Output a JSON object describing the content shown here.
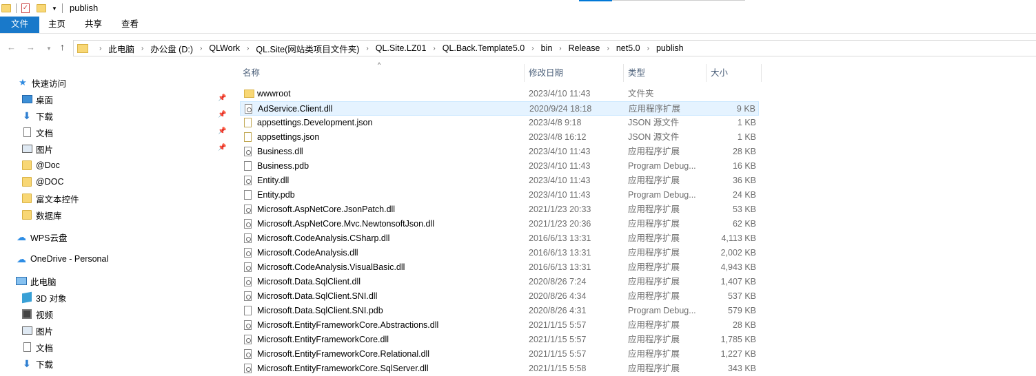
{
  "window": {
    "title": "publish"
  },
  "ribbon": {
    "tabs": {
      "file": "文件",
      "home": "主页",
      "share": "共享",
      "view": "查看"
    }
  },
  "address": {
    "crumbs": [
      "此电脑",
      "办公盘 (D:)",
      "QLWork",
      "QL.Site(网站类项目文件夹)",
      "QL.Site.LZ01",
      "QL.Back.Template5.0",
      "bin",
      "Release",
      "net5.0",
      "publish"
    ]
  },
  "sidebar": {
    "quick_access": "快速访问",
    "pinned": [
      {
        "label": "桌面",
        "icon": "desktop-icon"
      },
      {
        "label": "下载",
        "icon": "download-icon"
      },
      {
        "label": "文档",
        "icon": "document-icon"
      },
      {
        "label": "图片",
        "icon": "picture-icon"
      }
    ],
    "folders": [
      "@Doc",
      "@DOC",
      "富文本控件",
      "数据库"
    ],
    "wps": "WPS云盘",
    "onedrive": "OneDrive - Personal",
    "this_pc": "此电脑",
    "pc_items": [
      {
        "label": "3D 对象",
        "icon": "3d-objects-icon"
      },
      {
        "label": "视频",
        "icon": "video-icon"
      },
      {
        "label": "图片",
        "icon": "picture-icon"
      },
      {
        "label": "文档",
        "icon": "document-icon"
      },
      {
        "label": "下载",
        "icon": "download-icon"
      }
    ]
  },
  "columns": {
    "name": "名称",
    "date": "修改日期",
    "type": "类型",
    "size": "大小"
  },
  "files": [
    {
      "name": "wwwroot",
      "date": "2023/4/10 11:43",
      "type": "文件夹",
      "size": "",
      "icon": "folder"
    },
    {
      "name": "AdService.Client.dll",
      "date": "2020/9/24 18:18",
      "type": "应用程序扩展",
      "size": "9 KB",
      "icon": "dll",
      "selected": true
    },
    {
      "name": "appsettings.Development.json",
      "date": "2023/4/8 9:18",
      "type": "JSON 源文件",
      "size": "1 KB",
      "icon": "json"
    },
    {
      "name": "appsettings.json",
      "date": "2023/4/8 16:12",
      "type": "JSON 源文件",
      "size": "1 KB",
      "icon": "json"
    },
    {
      "name": "Business.dll",
      "date": "2023/4/10 11:43",
      "type": "应用程序扩展",
      "size": "28 KB",
      "icon": "dll"
    },
    {
      "name": "Business.pdb",
      "date": "2023/4/10 11:43",
      "type": "Program Debug...",
      "size": "16 KB",
      "icon": "pdb"
    },
    {
      "name": "Entity.dll",
      "date": "2023/4/10 11:43",
      "type": "应用程序扩展",
      "size": "36 KB",
      "icon": "dll"
    },
    {
      "name": "Entity.pdb",
      "date": "2023/4/10 11:43",
      "type": "Program Debug...",
      "size": "24 KB",
      "icon": "pdb"
    },
    {
      "name": "Microsoft.AspNetCore.JsonPatch.dll",
      "date": "2021/1/23 20:33",
      "type": "应用程序扩展",
      "size": "53 KB",
      "icon": "dll"
    },
    {
      "name": "Microsoft.AspNetCore.Mvc.NewtonsoftJson.dll",
      "date": "2021/1/23 20:36",
      "type": "应用程序扩展",
      "size": "62 KB",
      "icon": "dll"
    },
    {
      "name": "Microsoft.CodeAnalysis.CSharp.dll",
      "date": "2016/6/13 13:31",
      "type": "应用程序扩展",
      "size": "4,113 KB",
      "icon": "dll"
    },
    {
      "name": "Microsoft.CodeAnalysis.dll",
      "date": "2016/6/13 13:31",
      "type": "应用程序扩展",
      "size": "2,002 KB",
      "icon": "dll"
    },
    {
      "name": "Microsoft.CodeAnalysis.VisualBasic.dll",
      "date": "2016/6/13 13:31",
      "type": "应用程序扩展",
      "size": "4,943 KB",
      "icon": "dll"
    },
    {
      "name": "Microsoft.Data.SqlClient.dll",
      "date": "2020/8/26 7:24",
      "type": "应用程序扩展",
      "size": "1,407 KB",
      "icon": "dll"
    },
    {
      "name": "Microsoft.Data.SqlClient.SNI.dll",
      "date": "2020/8/26 4:34",
      "type": "应用程序扩展",
      "size": "537 KB",
      "icon": "dll"
    },
    {
      "name": "Microsoft.Data.SqlClient.SNI.pdb",
      "date": "2020/8/26 4:31",
      "type": "Program Debug...",
      "size": "579 KB",
      "icon": "pdb"
    },
    {
      "name": "Microsoft.EntityFrameworkCore.Abstractions.dll",
      "date": "2021/1/15 5:57",
      "type": "应用程序扩展",
      "size": "28 KB",
      "icon": "dll"
    },
    {
      "name": "Microsoft.EntityFrameworkCore.dll",
      "date": "2021/1/15 5:57",
      "type": "应用程序扩展",
      "size": "1,785 KB",
      "icon": "dll"
    },
    {
      "name": "Microsoft.EntityFrameworkCore.Relational.dll",
      "date": "2021/1/15 5:57",
      "type": "应用程序扩展",
      "size": "1,227 KB",
      "icon": "dll"
    },
    {
      "name": "Microsoft.EntityFrameworkCore.SqlServer.dll",
      "date": "2021/1/15 5:58",
      "type": "应用程序扩展",
      "size": "343 KB",
      "icon": "dll"
    }
  ]
}
